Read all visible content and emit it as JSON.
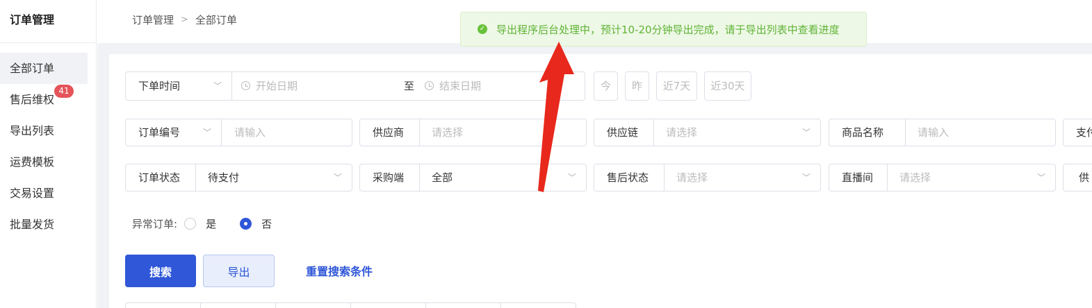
{
  "sidebar": {
    "title": "订单管理",
    "items": [
      {
        "label": "全部订单",
        "active": true
      },
      {
        "label": "售后维权",
        "badge": "41"
      },
      {
        "label": "导出列表"
      },
      {
        "label": "运费模板"
      },
      {
        "label": "交易设置"
      },
      {
        "label": "批量发货"
      }
    ]
  },
  "breadcrumb": [
    "订单管理",
    "全部订单"
  ],
  "toast": {
    "message": "导出程序后台处理中，预计10-20分钟导出完成，请于导出列表中查看进度",
    "color": "#67c23a"
  },
  "date_filter": {
    "type_label": "下单时间",
    "start_placeholder": "开始日期",
    "separator": "至",
    "end_placeholder": "结束日期",
    "quick": [
      "今",
      "昨",
      "近7天",
      "近30天"
    ]
  },
  "filters_row1": [
    {
      "label": "订单编号",
      "value": "请输入"
    },
    {
      "label": "供应商",
      "value": "请选择"
    },
    {
      "label": "供应链",
      "value": "请选择"
    },
    {
      "label": "商品名称",
      "value": "请输入"
    },
    {
      "label": "支付"
    }
  ],
  "filters_row2": [
    {
      "label": "订单状态",
      "value": "待支付"
    },
    {
      "label": "采购端",
      "value": "全部"
    },
    {
      "label": "售后状态",
      "value": "请选择"
    },
    {
      "label": "直播间",
      "value": "请选择"
    },
    {
      "label": "供"
    }
  ],
  "abnormal": {
    "label": "异常订单:",
    "yes": "是",
    "no": "否",
    "selected": "否"
  },
  "actions": {
    "search": "搜索",
    "export": "导出",
    "reset": "重置搜索条件"
  },
  "colors": {
    "primary": "#2f57d8",
    "badge": "#e4545a",
    "annotation_arrow": "#e8281c"
  }
}
